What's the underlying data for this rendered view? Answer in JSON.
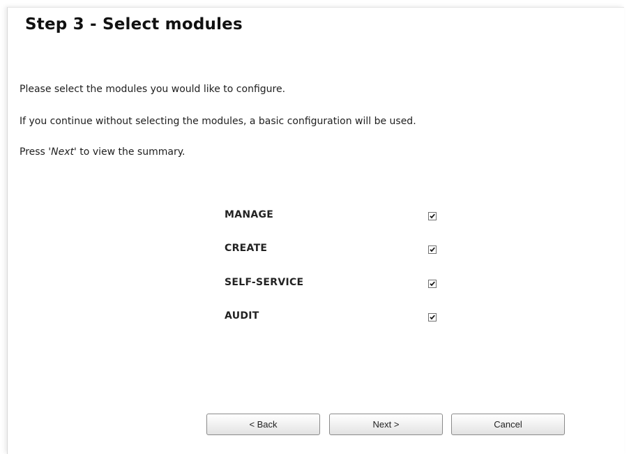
{
  "page": {
    "title": "Step 3 - Select modules",
    "intro_line1": "Please select the modules you would like to configure.",
    "intro_line2": "If you continue without selecting the modules, a basic configuration will be used.",
    "intro_line3_before": "Press ",
    "intro_line3_emphasis": "'Next'",
    "intro_line3_after": " to view the summary."
  },
  "modules": [
    {
      "label": "MANAGE",
      "checked": true
    },
    {
      "label": "CREATE",
      "checked": true
    },
    {
      "label": "SELF-SERVICE",
      "checked": true
    },
    {
      "label": "AUDIT",
      "checked": true
    }
  ],
  "buttons": {
    "back": "< Back",
    "next": "Next >",
    "cancel": "Cancel"
  },
  "icons": {
    "checkbox_check": "checkmark-icon"
  },
  "colors": {
    "checkmark": "#1a1a1a",
    "checkbox_border": "#707070"
  }
}
